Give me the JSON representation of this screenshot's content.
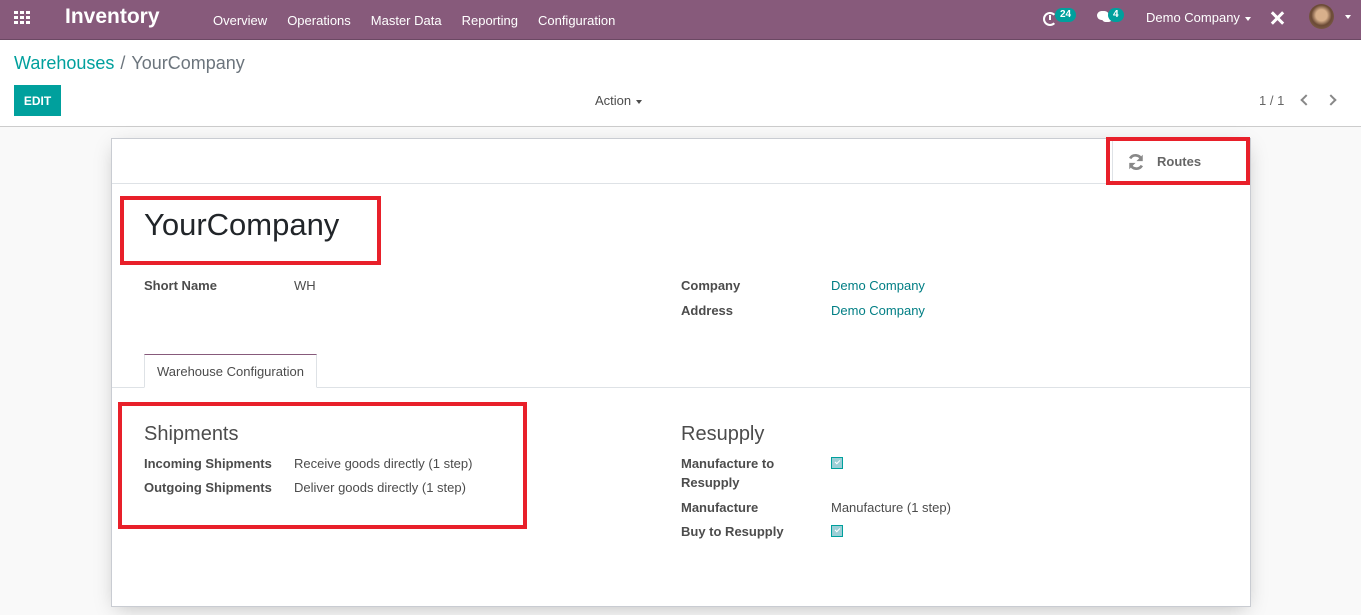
{
  "navbar": {
    "app_name": "Inventory",
    "menu": [
      "Overview",
      "Operations",
      "Master Data",
      "Reporting",
      "Configuration"
    ],
    "activity_count": "24",
    "message_count": "4",
    "company": "Demo Company",
    "icons": [
      "apps-icon",
      "clock-icon",
      "chat-icon",
      "debug-icon",
      "avatar"
    ]
  },
  "control_panel": {
    "breadcrumb": {
      "parent": "Warehouses",
      "separator": "/",
      "current": "YourCompany"
    },
    "edit_label": "EDIT",
    "action_label": "Action",
    "pager": "1 / 1"
  },
  "sheet": {
    "smart_button": {
      "label": "Routes",
      "icon": "refresh-icon"
    },
    "title": "YourCompany",
    "fields_left": [
      {
        "label": "Short Name",
        "value": "WH"
      }
    ],
    "fields_right": [
      {
        "label": "Company",
        "value": "Demo Company"
      },
      {
        "label": "Address",
        "value": "Demo Company"
      }
    ],
    "tab": "Warehouse Configuration",
    "shipments": {
      "title": "Shipments",
      "rows": [
        {
          "label": "Incoming Shipments",
          "value": "Receive goods directly (1 step)"
        },
        {
          "label": "Outgoing Shipments",
          "value": "Deliver goods directly (1 step)"
        }
      ]
    },
    "resupply": {
      "title": "Resupply",
      "manufacture_to_resupply": {
        "label_line1": "Manufacture to",
        "label_line2": "Resupply",
        "checked": true
      },
      "manufacture": {
        "label": "Manufacture",
        "value": "Manufacture (1 step)"
      },
      "buy_to_resupply": {
        "label": "Buy to Resupply",
        "checked": true
      }
    }
  },
  "colors": {
    "navbar": "#875a7b",
    "accent": "#00a09d",
    "highlight": "#e8202a"
  }
}
